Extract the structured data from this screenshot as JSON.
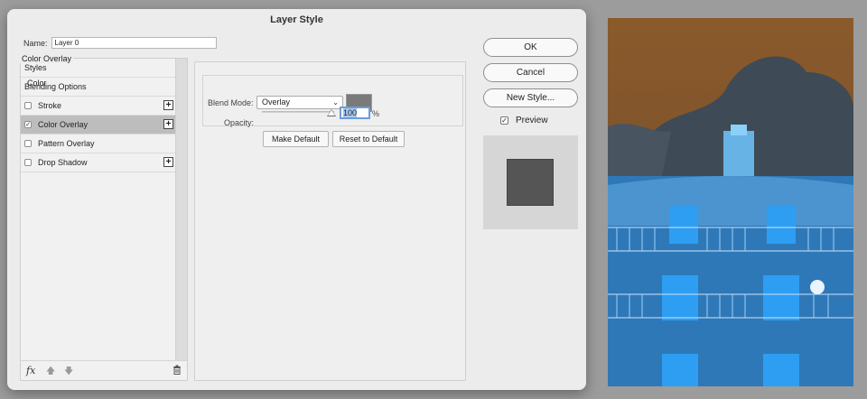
{
  "dialog": {
    "title": "Layer Style",
    "name_label": "Name:",
    "name_value": "Layer 0"
  },
  "left_panel": {
    "items": [
      {
        "label": "Styles",
        "checkbox": false,
        "plus": false,
        "selected": false
      },
      {
        "label": "Blending Options",
        "checkbox": false,
        "plus": false,
        "selected": false
      },
      {
        "label": "Stroke",
        "checkbox": true,
        "checked": false,
        "plus": true,
        "selected": false
      },
      {
        "label": "Color Overlay",
        "checkbox": true,
        "checked": true,
        "plus": true,
        "selected": true
      },
      {
        "label": "Pattern Overlay",
        "checkbox": true,
        "checked": false,
        "plus": false,
        "selected": false
      },
      {
        "label": "Drop Shadow",
        "checkbox": true,
        "checked": false,
        "plus": true,
        "selected": false
      }
    ],
    "footer": {
      "fx_label": "fx",
      "icons": [
        "fx-icon",
        "move-up-icon",
        "move-down-icon",
        "trash-icon"
      ]
    }
  },
  "color_overlay": {
    "group_title": "Color Overlay",
    "section_title": "Color",
    "blend_mode_label": "Blend Mode:",
    "blend_mode_value": "Overlay",
    "overlay_color": "#7a7a7a",
    "opacity_label": "Opacity:",
    "opacity_value": "100",
    "opacity_unit": "%",
    "make_default_label": "Make Default",
    "reset_default_label": "Reset to Default"
  },
  "right_buttons": {
    "ok_label": "OK",
    "cancel_label": "Cancel",
    "new_style_label": "New Style...",
    "preview_label": "Preview",
    "preview_checked": true,
    "preview_color": "#555555"
  }
}
